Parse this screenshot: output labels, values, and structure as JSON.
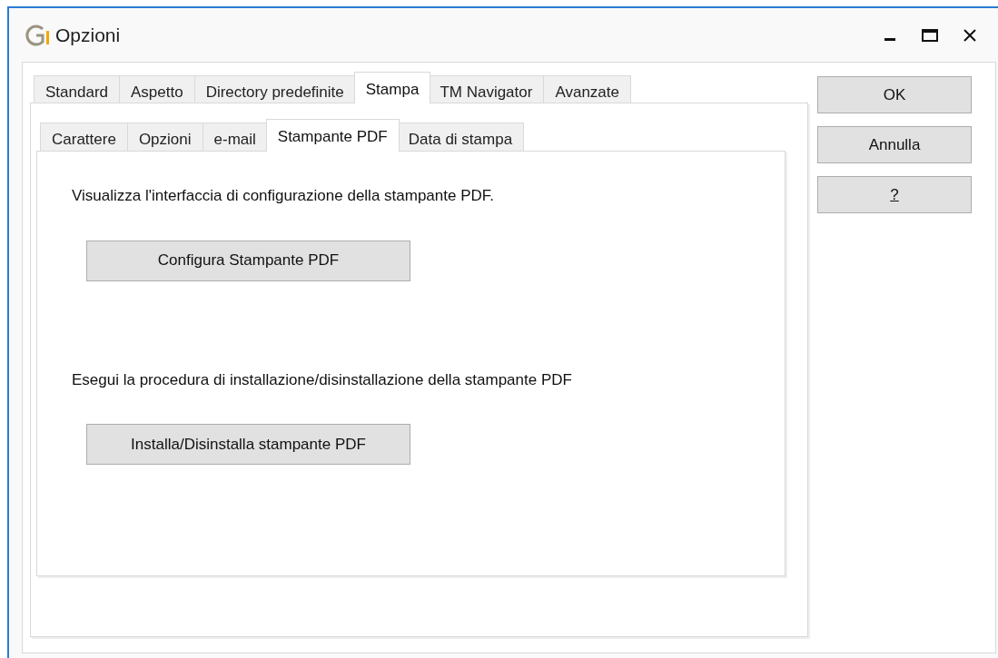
{
  "window": {
    "title": "Opzioni"
  },
  "tabs": [
    {
      "label": "Standard",
      "selected": false
    },
    {
      "label": "Aspetto",
      "selected": false
    },
    {
      "label": "Directory predefinite",
      "selected": false
    },
    {
      "label": "Stampa",
      "selected": true
    },
    {
      "label": "TM Navigator",
      "selected": false
    },
    {
      "label": "Avanzate",
      "selected": false
    }
  ],
  "subtabs": [
    {
      "label": "Carattere",
      "selected": false
    },
    {
      "label": "Opzioni",
      "selected": false
    },
    {
      "label": "e-mail",
      "selected": false
    },
    {
      "label": "Stampante PDF",
      "selected": true
    },
    {
      "label": "Data di stampa",
      "selected": false
    }
  ],
  "sections": [
    {
      "text": "Visualizza l'interfaccia di configurazione della stampante PDF.",
      "button": "Configura Stampante PDF"
    },
    {
      "text": "Esegui la procedura di installazione/disinstallazione della stampante PDF",
      "button": "Installa/Disinstalla stampante PDF"
    }
  ],
  "buttons": [
    {
      "label": "OK",
      "underlined": false
    },
    {
      "label": "Annulla",
      "underlined": false
    },
    {
      "label": "?",
      "underlined": true
    }
  ]
}
